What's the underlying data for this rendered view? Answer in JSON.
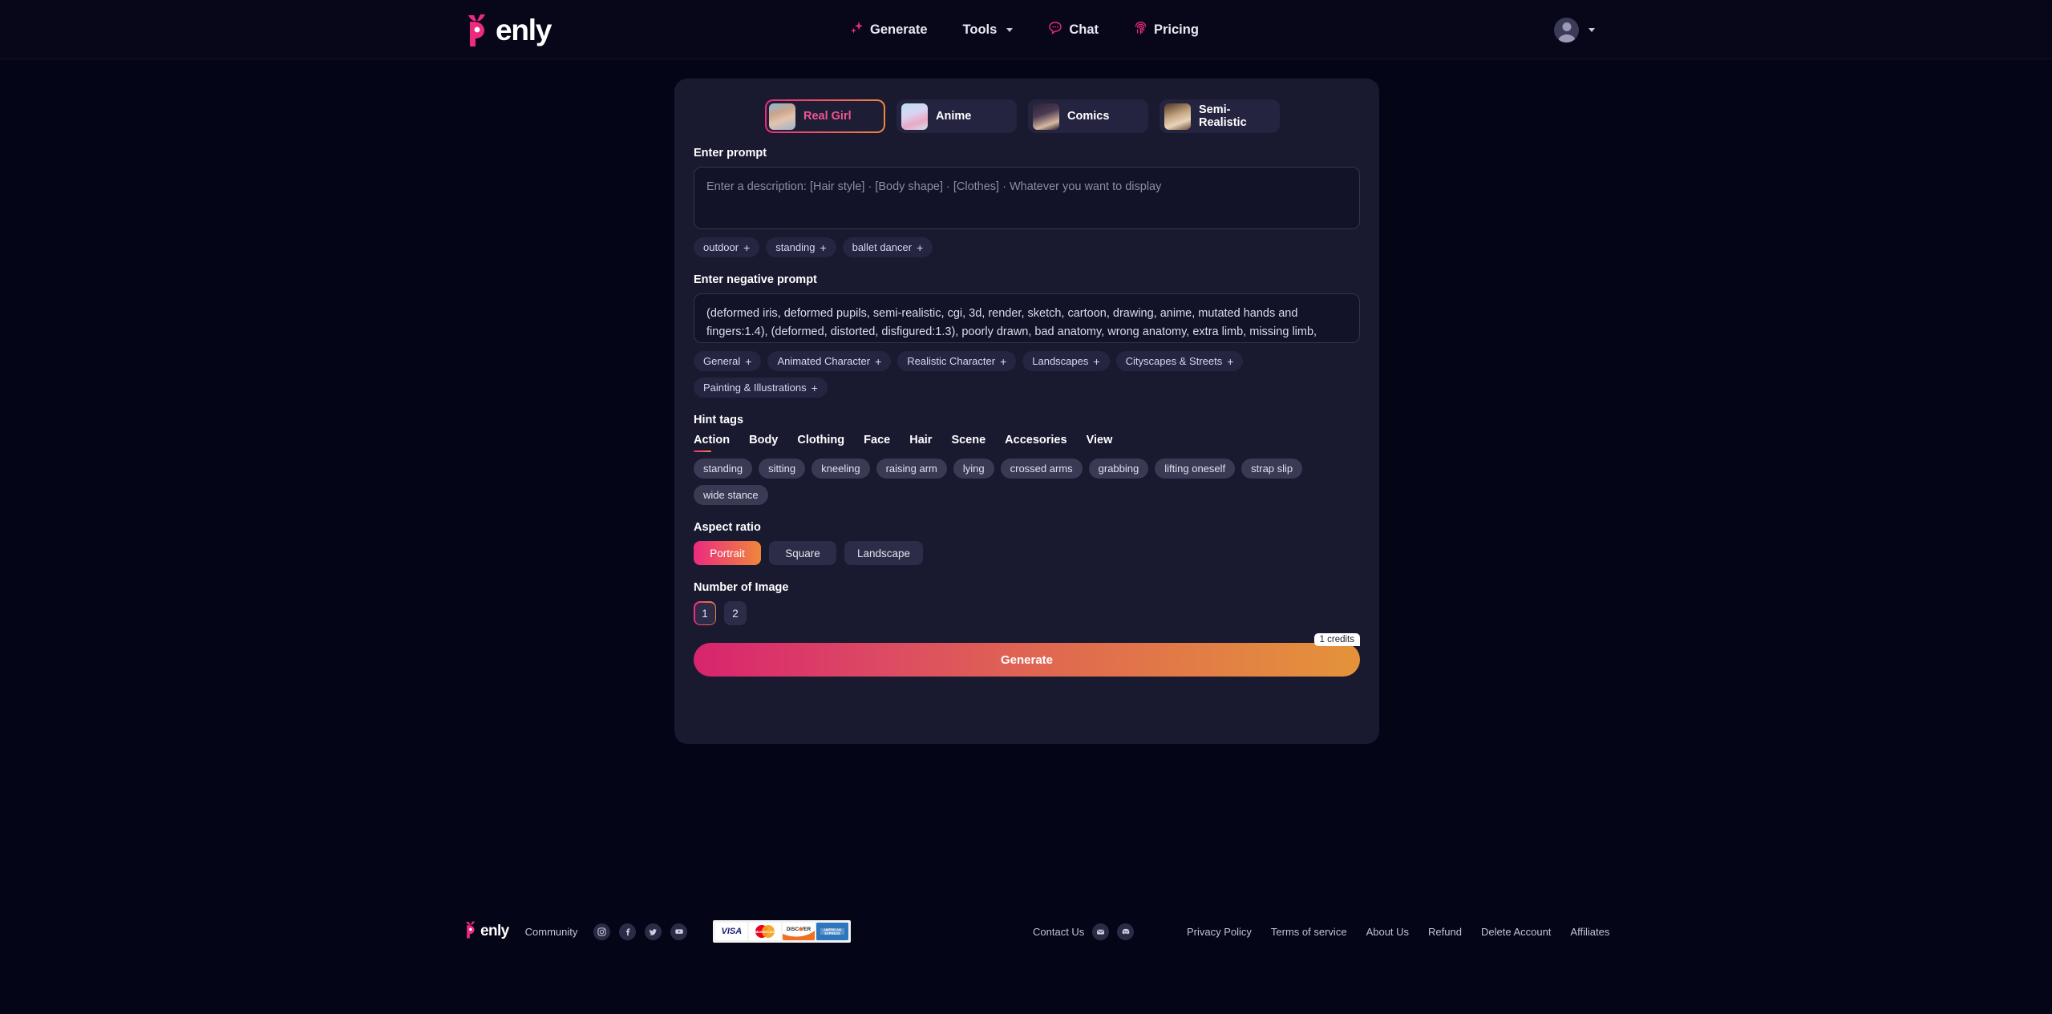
{
  "brand": {
    "name": "enly",
    "logo_icon": "penly-devil-logo"
  },
  "header": {
    "nav": [
      {
        "label": "Generate",
        "icon": "sparkle-icon",
        "has_caret": false
      },
      {
        "label": "Tools",
        "icon": "",
        "has_caret": true
      },
      {
        "label": "Chat",
        "icon": "chat-bubble-icon",
        "has_caret": false
      },
      {
        "label": "Pricing",
        "icon": "fingerprint-icon",
        "has_caret": false
      }
    ],
    "account_icon": "user-avatar-icon"
  },
  "styles": {
    "tabs": [
      {
        "label": "Real Girl",
        "active": true
      },
      {
        "label": "Anime",
        "active": false
      },
      {
        "label": "Comics",
        "active": false
      },
      {
        "label": "Semi-Realistic",
        "active": false
      }
    ]
  },
  "prompt": {
    "label": "Enter prompt",
    "value": "",
    "placeholder": "Enter a description: [Hair style] · [Body shape] · [Clothes] · Whatever you want to display",
    "suggestions": [
      "outdoor",
      "standing",
      "ballet dancer"
    ]
  },
  "negative_prompt": {
    "label": "Enter negative prompt",
    "value": "(deformed iris, deformed pupils, semi-realistic, cgi, 3d, render, sketch, cartoon, drawing, anime, mutated hands and fingers:1.4), (deformed, distorted, disfigured:1.3), poorly drawn, bad anatomy, wrong anatomy, extra limb, missing limb, floating limbs, disconnected limbs, mutation, mutated, ugly, disgusting",
    "categories": [
      "General",
      "Animated Character",
      "Realistic Character",
      "Landscapes",
      "Cityscapes & Streets",
      "Painting & Illustrations"
    ]
  },
  "hint_tags": {
    "label": "Hint tags",
    "categories": [
      {
        "label": "Action",
        "active": true
      },
      {
        "label": "Body",
        "active": false
      },
      {
        "label": "Clothing",
        "active": false
      },
      {
        "label": "Face",
        "active": false
      },
      {
        "label": "Hair",
        "active": false
      },
      {
        "label": "Scene",
        "active": false
      },
      {
        "label": "Accesories",
        "active": false
      },
      {
        "label": "View",
        "active": false
      }
    ],
    "tags": [
      "standing",
      "sitting",
      "kneeling",
      "raising arm",
      "lying",
      "crossed arms",
      "grabbing",
      "lifting oneself",
      "strap slip",
      "wide stance"
    ]
  },
  "aspect_ratio": {
    "label": "Aspect ratio",
    "options": [
      {
        "label": "Portrait",
        "active": true
      },
      {
        "label": "Square",
        "active": false
      },
      {
        "label": "Landscape",
        "active": false
      }
    ]
  },
  "number_of_image": {
    "label": "Number of Image",
    "options": [
      {
        "label": "1",
        "active": true
      },
      {
        "label": "2",
        "active": false
      }
    ]
  },
  "generate": {
    "label": "Generate",
    "credits_badge": "1 credits"
  },
  "footer": {
    "community_label": "Community",
    "social": [
      {
        "icon": "instagram-icon"
      },
      {
        "icon": "facebook-icon"
      },
      {
        "icon": "twitter-icon"
      },
      {
        "icon": "youtube-icon"
      }
    ],
    "payment_cards": [
      {
        "name": "VISA"
      },
      {
        "name": "MasterCard"
      },
      {
        "name": "DISCOVER"
      },
      {
        "name": "AMERICAN EXPRESS"
      }
    ],
    "contact_label": "Contact Us",
    "contact_icons": [
      {
        "icon": "email-icon"
      },
      {
        "icon": "discord-icon"
      }
    ],
    "links": [
      "Privacy Policy",
      "Terms of service",
      "About Us",
      "Refund",
      "Delete Account",
      "Affiliates"
    ]
  },
  "colors": {
    "page_bg": "#050518",
    "panel_bg": "#191930",
    "accent_pink": "#ec2a7f",
    "accent_orange": "#f0873b"
  }
}
